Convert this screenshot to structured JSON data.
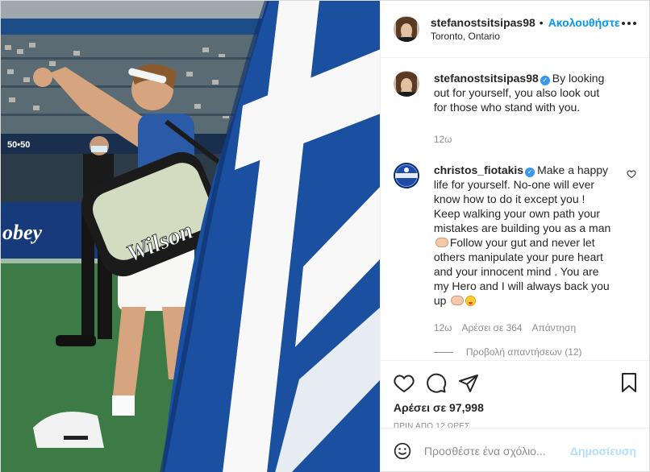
{
  "photo": {
    "description_icon": "tennis-player-photo",
    "banner_text": "50•50",
    "sponsor_text": "obey",
    "bag_brand": "Wilson"
  },
  "header": {
    "username": "stefanostsitsipas98",
    "separator": "•",
    "follow_label": "Ακολουθήστε",
    "location": "Toronto, Ontario",
    "more_icon": "more-options-icon"
  },
  "caption": {
    "username": "stefanostsitsipas98",
    "text": "By looking out for yourself, you also look out for those who stand with you.",
    "time": "12ω"
  },
  "comment": {
    "username": "christos_fiotakis",
    "text_1": "Make a happy life for yourself. No-one will ever know how to do it except you ! Keep walking your own path your mistakes are building you as a man",
    "text_2": "Follow your gut and never let others manipulate your pure heart and your innocent mind . You are my Hero and I will always back you up",
    "time": "12ω",
    "likes": "Αρέσει σε 364",
    "reply_label": "Απάντηση",
    "view_replies": "Προβολή απαντήσεων (12)"
  },
  "actions": {
    "likes_count": "Αρέσει σε 97,998",
    "time_ago": "ΠΡΙΝ ΑΠΟ 12 ΩΡΕΣ"
  },
  "add_comment": {
    "placeholder": "Προσθέστε ένα σχόλιο...",
    "post_label": "Δημοσίευση"
  },
  "colors": {
    "accent": "#0095f6",
    "verified": "#3897f0",
    "muted": "#8e8e8e",
    "flag_blue": "#1b4fa0"
  }
}
